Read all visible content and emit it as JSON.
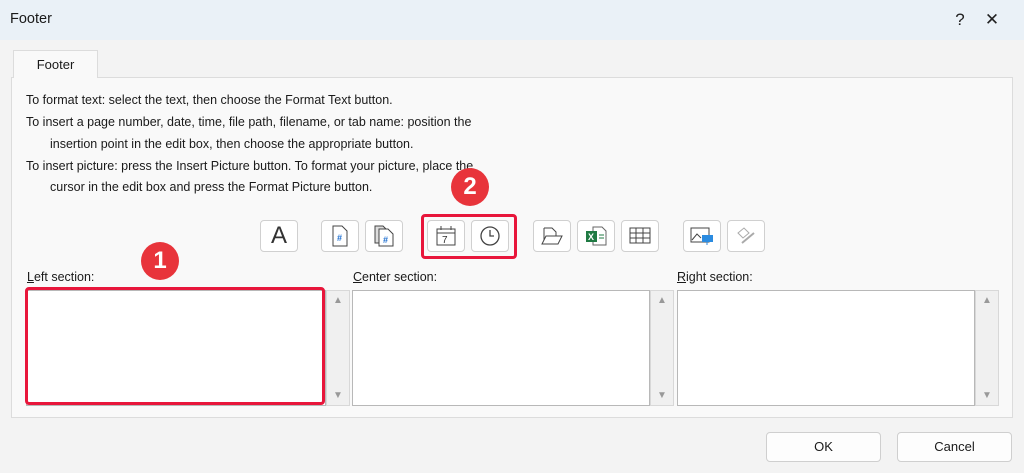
{
  "dialog": {
    "title": "Footer",
    "help_label": "?",
    "close_label": "✕"
  },
  "tab": {
    "label": "Footer"
  },
  "instructions": [
    "To format text:  select the text, then choose the Format Text button.",
    "To insert a page number, date, time, file path, filename, or tab name:  position the",
    "insertion point in the edit box, then choose the appropriate button.",
    "To insert picture: press the Insert Picture button.  To format your picture, place the",
    "cursor in the edit box and press the Format Picture button."
  ],
  "toolbar": {
    "format_text_glyph": "A",
    "page_number_glyph": "#",
    "date_glyph": "7"
  },
  "sections": {
    "left_first": "L",
    "left_rest": "eft section:",
    "center_first": "C",
    "center_rest": "enter section:",
    "right_first": "R",
    "right_rest": "ight section:",
    "left_value": "",
    "center_value": "",
    "right_value": ""
  },
  "annotations": {
    "badge1": "1",
    "badge2": "2",
    "highlight_color": "#e8163b"
  },
  "buttons": {
    "ok": "OK",
    "cancel": "Cancel"
  }
}
